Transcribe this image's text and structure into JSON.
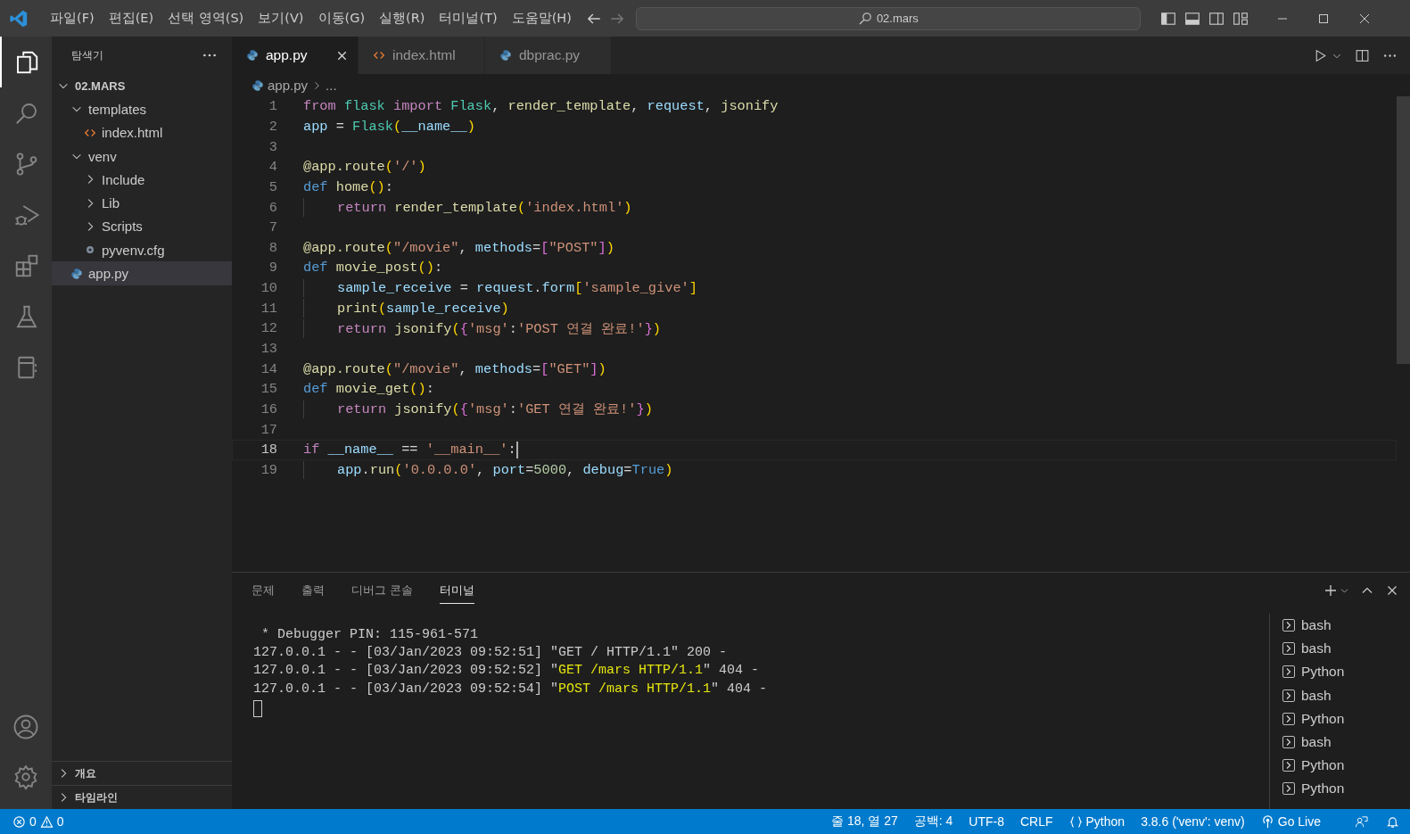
{
  "title_bar": {
    "menus": [
      "파일(F)",
      "편집(E)",
      "선택 영역(S)",
      "보기(V)",
      "이동(G)",
      "실행(R)",
      "터미널(T)",
      "도움말(H)"
    ],
    "search": {
      "value": "02.mars"
    }
  },
  "activity_bar": {
    "items": [
      {
        "kind": "files",
        "selected": true
      },
      {
        "kind": "search",
        "selected": false
      },
      {
        "kind": "source-control",
        "selected": false
      },
      {
        "kind": "run-debug",
        "selected": false
      },
      {
        "kind": "extensions",
        "selected": false
      },
      {
        "kind": "flask",
        "selected": false
      },
      {
        "kind": "notebook",
        "selected": false
      }
    ]
  },
  "sidebar": {
    "title": "탐색기",
    "tree": [
      {
        "label": "02.MARS",
        "kind": "root",
        "expanded": true,
        "selected": false,
        "children": [
          {
            "label": "templates",
            "kind": "folder",
            "expanded": true,
            "selected": false,
            "children": [
              {
                "label": "index.html",
                "kind": "html",
                "selected": false
              }
            ]
          },
          {
            "label": "venv",
            "kind": "folder",
            "expanded": true,
            "selected": false,
            "children": [
              {
                "label": "Include",
                "kind": "folder",
                "expanded": false,
                "selected": false
              },
              {
                "label": "Lib",
                "kind": "folder",
                "expanded": false,
                "selected": false
              },
              {
                "label": "Scripts",
                "kind": "folder",
                "expanded": false,
                "selected": false
              },
              {
                "label": "pyvenv.cfg",
                "kind": "config",
                "selected": false
              }
            ]
          },
          {
            "label": "app.py",
            "kind": "python",
            "selected": true
          }
        ]
      }
    ],
    "sections": [
      {
        "label": "개요",
        "expanded": false
      },
      {
        "label": "타임라인",
        "expanded": false
      }
    ]
  },
  "tabs": [
    {
      "label": "app.py",
      "kind": "python",
      "selected": true
    },
    {
      "label": "index.html",
      "kind": "html",
      "selected": false
    },
    {
      "label": "dbprac.py",
      "kind": "python",
      "selected": false
    }
  ],
  "breadcrumb": {
    "file": "app.py",
    "rest": "..."
  },
  "code": [
    {
      "number": "1",
      "indented": false,
      "current": false,
      "tokens": [
        {
          "text": "from ",
          "kind": "kw"
        },
        {
          "text": "flask ",
          "kind": "mod"
        },
        {
          "text": "import ",
          "kind": "kw"
        },
        {
          "text": "Flask",
          "kind": "mod"
        },
        {
          "text": ", ",
          "kind": "p"
        },
        {
          "text": "render_template",
          "kind": "fn"
        },
        {
          "text": ", ",
          "kind": "p"
        },
        {
          "text": "request",
          "kind": "var"
        },
        {
          "text": ", ",
          "kind": "p"
        },
        {
          "text": "jsonify",
          "kind": "fn"
        }
      ]
    },
    {
      "number": "2",
      "indented": false,
      "current": false,
      "tokens": [
        {
          "text": "app",
          "kind": "var"
        },
        {
          "text": " = ",
          "kind": "p"
        },
        {
          "text": "Flask",
          "kind": "mod"
        },
        {
          "text": "(",
          "kind": "b1"
        },
        {
          "text": "__name__",
          "kind": "var"
        },
        {
          "text": ")",
          "kind": "b1"
        }
      ]
    },
    {
      "number": "3",
      "indented": false,
      "current": false
    },
    {
      "number": "4",
      "indented": false,
      "current": false,
      "tokens": [
        {
          "text": "@app.route",
          "kind": "fn"
        },
        {
          "text": "(",
          "kind": "b1"
        },
        {
          "text": "'/'",
          "kind": "str"
        },
        {
          "text": ")",
          "kind": "b1"
        }
      ]
    },
    {
      "number": "5",
      "indented": false,
      "current": false,
      "tokens": [
        {
          "text": "def ",
          "kind": "kwd"
        },
        {
          "text": "home",
          "kind": "fn"
        },
        {
          "text": "()",
          "kind": "b1"
        },
        {
          "text": ":",
          "kind": "p"
        }
      ]
    },
    {
      "number": "6",
      "indented": true,
      "current": false,
      "tokens": [
        {
          "text": "return ",
          "kind": "kw"
        },
        {
          "text": "render_template",
          "kind": "fn"
        },
        {
          "text": "(",
          "kind": "b1"
        },
        {
          "text": "'index.html'",
          "kind": "str"
        },
        {
          "text": ")",
          "kind": "b1"
        }
      ]
    },
    {
      "number": "7",
      "indented": false,
      "current": false
    },
    {
      "number": "8",
      "indented": false,
      "current": false,
      "tokens": [
        {
          "text": "@app.route",
          "kind": "fn"
        },
        {
          "text": "(",
          "kind": "b1"
        },
        {
          "text": "\"/movie\"",
          "kind": "str"
        },
        {
          "text": ", ",
          "kind": "p"
        },
        {
          "text": "methods",
          "kind": "var"
        },
        {
          "text": "=",
          "kind": "p"
        },
        {
          "text": "[",
          "kind": "b2"
        },
        {
          "text": "\"POST\"",
          "kind": "str"
        },
        {
          "text": "]",
          "kind": "b2"
        },
        {
          "text": ")",
          "kind": "b1"
        }
      ]
    },
    {
      "number": "9",
      "indented": false,
      "current": false,
      "tokens": [
        {
          "text": "def ",
          "kind": "kwd"
        },
        {
          "text": "movie_post",
          "kind": "fn"
        },
        {
          "text": "()",
          "kind": "b1"
        },
        {
          "text": ":",
          "kind": "p"
        }
      ]
    },
    {
      "number": "10",
      "indented": true,
      "current": false,
      "tokens": [
        {
          "text": "sample_receive",
          "kind": "var"
        },
        {
          "text": " = ",
          "kind": "p"
        },
        {
          "text": "request",
          "kind": "var"
        },
        {
          "text": ".",
          "kind": "p"
        },
        {
          "text": "form",
          "kind": "var"
        },
        {
          "text": "[",
          "kind": "b1"
        },
        {
          "text": "'sample_give'",
          "kind": "str"
        },
        {
          "text": "]",
          "kind": "b1"
        }
      ]
    },
    {
      "number": "11",
      "indented": true,
      "current": false,
      "tokens": [
        {
          "text": "print",
          "kind": "fn"
        },
        {
          "text": "(",
          "kind": "b1"
        },
        {
          "text": "sample_receive",
          "kind": "var"
        },
        {
          "text": ")",
          "kind": "b1"
        }
      ]
    },
    {
      "number": "12",
      "indented": true,
      "current": false,
      "tokens": [
        {
          "text": "return ",
          "kind": "kw"
        },
        {
          "text": "jsonify",
          "kind": "fn"
        },
        {
          "text": "(",
          "kind": "b1"
        },
        {
          "text": "{",
          "kind": "b2"
        },
        {
          "text": "'msg'",
          "kind": "str"
        },
        {
          "text": ":",
          "kind": "p"
        },
        {
          "text": "'POST 연결 완료!'",
          "kind": "str"
        },
        {
          "text": "}",
          "kind": "b2"
        },
        {
          "text": ")",
          "kind": "b1"
        }
      ]
    },
    {
      "number": "13",
      "indented": false,
      "current": false
    },
    {
      "number": "14",
      "indented": false,
      "current": false,
      "tokens": [
        {
          "text": "@app.route",
          "kind": "fn"
        },
        {
          "text": "(",
          "kind": "b1"
        },
        {
          "text": "\"/movie\"",
          "kind": "str"
        },
        {
          "text": ", ",
          "kind": "p"
        },
        {
          "text": "methods",
          "kind": "var"
        },
        {
          "text": "=",
          "kind": "p"
        },
        {
          "text": "[",
          "kind": "b2"
        },
        {
          "text": "\"GET\"",
          "kind": "str"
        },
        {
          "text": "]",
          "kind": "b2"
        },
        {
          "text": ")",
          "kind": "b1"
        }
      ]
    },
    {
      "number": "15",
      "indented": false,
      "current": false,
      "tokens": [
        {
          "text": "def ",
          "kind": "kwd"
        },
        {
          "text": "movie_get",
          "kind": "fn"
        },
        {
          "text": "()",
          "kind": "b1"
        },
        {
          "text": ":",
          "kind": "p"
        }
      ]
    },
    {
      "number": "16",
      "indented": true,
      "current": false,
      "tokens": [
        {
          "text": "return ",
          "kind": "kw"
        },
        {
          "text": "jsonify",
          "kind": "fn"
        },
        {
          "text": "(",
          "kind": "b1"
        },
        {
          "text": "{",
          "kind": "b2"
        },
        {
          "text": "'msg'",
          "kind": "str"
        },
        {
          "text": ":",
          "kind": "p"
        },
        {
          "text": "'GET 연결 완료!'",
          "kind": "str"
        },
        {
          "text": "}",
          "kind": "b2"
        },
        {
          "text": ")",
          "kind": "b1"
        }
      ]
    },
    {
      "number": "17",
      "indented": false,
      "current": false
    },
    {
      "number": "18",
      "indented": false,
      "current": true,
      "tokens": [
        {
          "text": "if ",
          "kind": "kw"
        },
        {
          "text": "__name__",
          "kind": "var"
        },
        {
          "text": " == ",
          "kind": "p"
        },
        {
          "text": "'__main__'",
          "kind": "str"
        },
        {
          "text": ":",
          "kind": "p"
        }
      ]
    },
    {
      "number": "19",
      "indented": true,
      "current": false,
      "tokens": [
        {
          "text": "app",
          "kind": "var"
        },
        {
          "text": ".",
          "kind": "p"
        },
        {
          "text": "run",
          "kind": "fn"
        },
        {
          "text": "(",
          "kind": "b1"
        },
        {
          "text": "'0.0.0.0'",
          "kind": "str"
        },
        {
          "text": ", ",
          "kind": "p"
        },
        {
          "text": "port",
          "kind": "var"
        },
        {
          "text": "=",
          "kind": "p"
        },
        {
          "text": "5000",
          "kind": "num"
        },
        {
          "text": ", ",
          "kind": "p"
        },
        {
          "text": "debug",
          "kind": "var"
        },
        {
          "text": "=",
          "kind": "p"
        },
        {
          "text": "True",
          "kind": "const"
        },
        {
          "text": ")",
          "kind": "b1"
        }
      ]
    }
  ],
  "panel": {
    "tabs": [
      {
        "label": "문제",
        "selected": false
      },
      {
        "label": "출력",
        "selected": false
      },
      {
        "label": "디버그 콘솔",
        "selected": false
      },
      {
        "label": "터미널",
        "selected": true
      }
    ],
    "terminal": [
      [
        {
          "text": " * Debugger PIN: 115-961-571",
          "kind": "plain"
        }
      ],
      [
        {
          "text": "127.0.0.1 - - [03/Jan/2023 09:52:51] \"GET / HTTP/1.1\" 200 -",
          "kind": "plain"
        }
      ],
      [
        {
          "text": "127.0.0.1 - - [03/Jan/2023 09:52:52] \"",
          "kind": "plain"
        },
        {
          "text": "GET /mars HTTP/1.1",
          "kind": "highlight"
        },
        {
          "text": "\" 404 -",
          "kind": "plain"
        }
      ],
      [
        {
          "text": "127.0.0.1 - - [03/Jan/2023 09:52:54] \"",
          "kind": "plain"
        },
        {
          "text": "POST /mars HTTP/1.1",
          "kind": "highlight"
        },
        {
          "text": "\" 404 -",
          "kind": "plain"
        }
      ]
    ],
    "terminals": [
      "bash",
      "bash",
      "Python",
      "bash",
      "Python",
      "bash",
      "Python",
      "Python"
    ]
  },
  "status_bar": {
    "errors": "0",
    "warnings": "0",
    "position": "줄 18, 열 27",
    "spaces": "공백: 4",
    "encoding": "UTF-8",
    "eol": "CRLF",
    "language": "Python",
    "interpreter": "3.8.6 ('venv': venv)",
    "live": "Go Live"
  }
}
